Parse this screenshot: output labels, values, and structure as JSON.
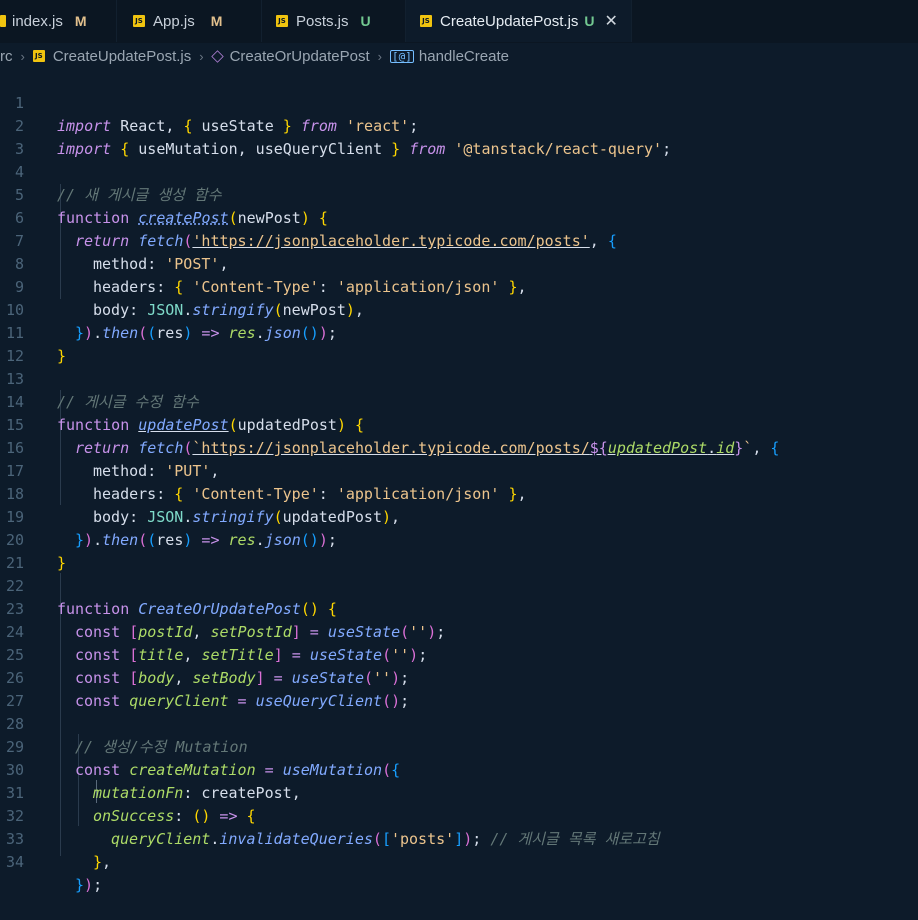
{
  "tabs": [
    {
      "label": "index.js",
      "status": "M",
      "active": false
    },
    {
      "label": "App.js",
      "status": "M",
      "active": false
    },
    {
      "label": "Posts.js",
      "status": "U",
      "active": false
    },
    {
      "label": "CreateUpdatePost.js",
      "status": "U",
      "active": true
    }
  ],
  "breadcrumb": {
    "root": "rc",
    "file": "CreateUpdatePost.js",
    "component": "CreateOrUpdatePost",
    "symbol": "handleCreate"
  },
  "editor": {
    "line_numbers": [
      "1",
      "2",
      "3",
      "4",
      "5",
      "6",
      "7",
      "8",
      "9",
      "10",
      "11",
      "12",
      "13",
      "14",
      "15",
      "16",
      "17",
      "18",
      "19",
      "20",
      "21",
      "22",
      "23",
      "24",
      "25",
      "26",
      "27",
      "28",
      "29",
      "30",
      "31",
      "32",
      "33",
      "34"
    ],
    "code": {
      "l1_import": "import",
      "l1_react": " React, ",
      "l1_b1": "{",
      "l1_usestate": " useState ",
      "l1_b2": "}",
      "l1_from": " from",
      "l1_str": " 'react'",
      "l1_end": ";",
      "l2_import": "import",
      "l2_b1": " {",
      "l2_names": " useMutation, useQueryClient ",
      "l2_b2": "}",
      "l2_from": " from",
      "l2_str": " '@tanstack/react-query'",
      "l2_end": ";",
      "l4_comment": "// 새 게시글 생성 함수",
      "l5_function": "function ",
      "l5_name": "createPost",
      "l5_p1": "(",
      "l5_param": "newPost",
      "l5_p2": ")",
      "l5_b": " {",
      "l6_return": "return ",
      "l6_fetch": "fetch",
      "l6_p": "(",
      "l6_url": "'https://jsonplaceholder.typicode.com/posts'",
      "l6_rest": ", {",
      "l7_key": "method",
      "l7_val": "'POST'",
      "l8_key": "headers",
      "l8_val": "'Content-Type'",
      "l8_val2": "'application/json'",
      "l9_key": "body",
      "l9_json": "JSON",
      "l9_stringify": "stringify",
      "l9_arg": "newPost",
      "l10_then": "then",
      "l10_res": "res",
      "l10_res2": "res",
      "l10_json": "json",
      "l13_comment": "// 게시글 수정 함수",
      "l14_name": "updatePost",
      "l14_param": "updatedPost",
      "l15_url1": "`https://jsonplaceholder.typicode.com/posts/",
      "l15_tpl": "${",
      "l15_obj": "updatedPost",
      "l15_prop": "id",
      "l15_tplend": "}",
      "l15_end": "`",
      "l16_val": "'PUT'",
      "l18_arg": "updatedPost",
      "l22_name": "CreateOrUpdatePost",
      "l23_a": "postId",
      "l23_b": "setPostId",
      "l24_a": "title",
      "l24_b": "setTitle",
      "l25_a": "body",
      "l25_b": "setBody",
      "l26_a": "queryClient",
      "l26_fn": "useQueryClient",
      "usestate": "useState",
      "empty_str": "''",
      "l28_comment": "// 생성/수정 Mutation",
      "l29_name": "createMutation",
      "l29_fn": "useMutation",
      "l30_key": "mutationFn",
      "l30_val": "createPost",
      "l31_key": "onSuccess",
      "l32_obj": "queryClient",
      "l32_fn": "invalidateQueries",
      "l32_str": "'posts'",
      "l32_comment": "// 게시글 목록 새로고침",
      "const": "const",
      "return": "return",
      "function": "function",
      "arrow": "=>"
    }
  },
  "colors": {
    "background": "#0d1b2a",
    "tab_modified": "#e2c08d",
    "tab_untracked": "#73c991",
    "js_icon": "#f1c40f"
  }
}
